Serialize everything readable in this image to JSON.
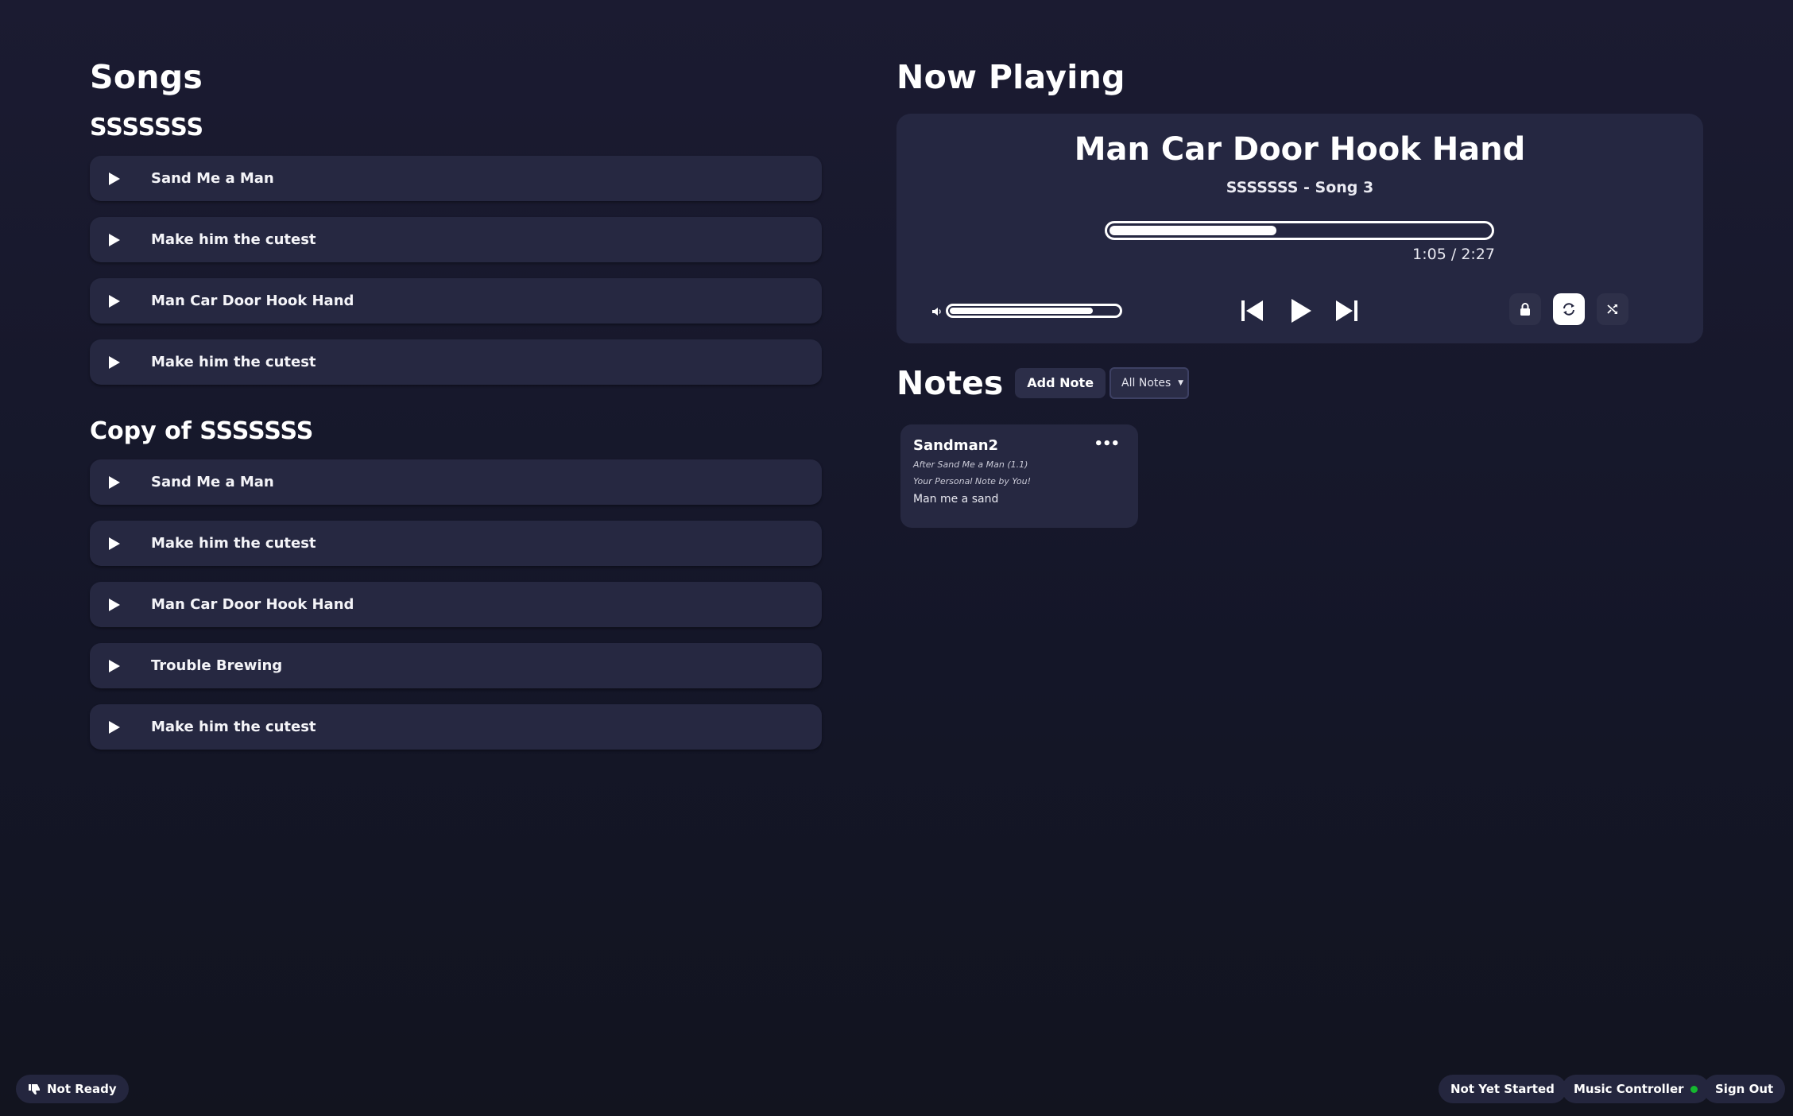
{
  "songs": {
    "heading": "Songs",
    "playlists": [
      {
        "name": "SSSSSSS",
        "songs": [
          "Sand Me a Man",
          "Make him the cutest",
          "Man Car Door Hook Hand",
          "Make him the cutest"
        ]
      },
      {
        "name": "Copy of SSSSSSS",
        "songs": [
          "Sand Me a Man",
          "Make him the cutest",
          "Man Car Door Hook Hand",
          "Trouble Brewing",
          "Make him the cutest"
        ]
      }
    ]
  },
  "now_playing": {
    "heading": "Now Playing",
    "song_title": "Man Car Door Hook Hand",
    "subtitle": "SSSSSSS - Song 3",
    "progress_fraction": 0.44,
    "time": "1:05 / 2:27",
    "volume_fraction": 0.85,
    "icons": {
      "volume": "volume-icon",
      "previous": "skip-previous-icon",
      "play": "play-icon",
      "next": "skip-next-icon",
      "lock": "lock-icon",
      "repeat": "repeat-icon",
      "shuffle": "shuffle-icon"
    }
  },
  "notes": {
    "heading": "Notes",
    "add_button": "Add Note",
    "filter_selected": "All Notes",
    "items": [
      {
        "author": "Sandman2",
        "after": "After Sand Me a Man (1.1)",
        "visibility": "Your Personal Note by You!",
        "body": "Man me a sand"
      }
    ]
  },
  "footer": {
    "not_ready": "Not Ready",
    "status": "Not Yet Started",
    "music_controller": "Music Controller",
    "sign_out": "Sign Out",
    "controller_status_color": "#15b82f"
  },
  "colors": {
    "background": "#171a2e",
    "card": "#262841",
    "accent": "#ffffff"
  }
}
